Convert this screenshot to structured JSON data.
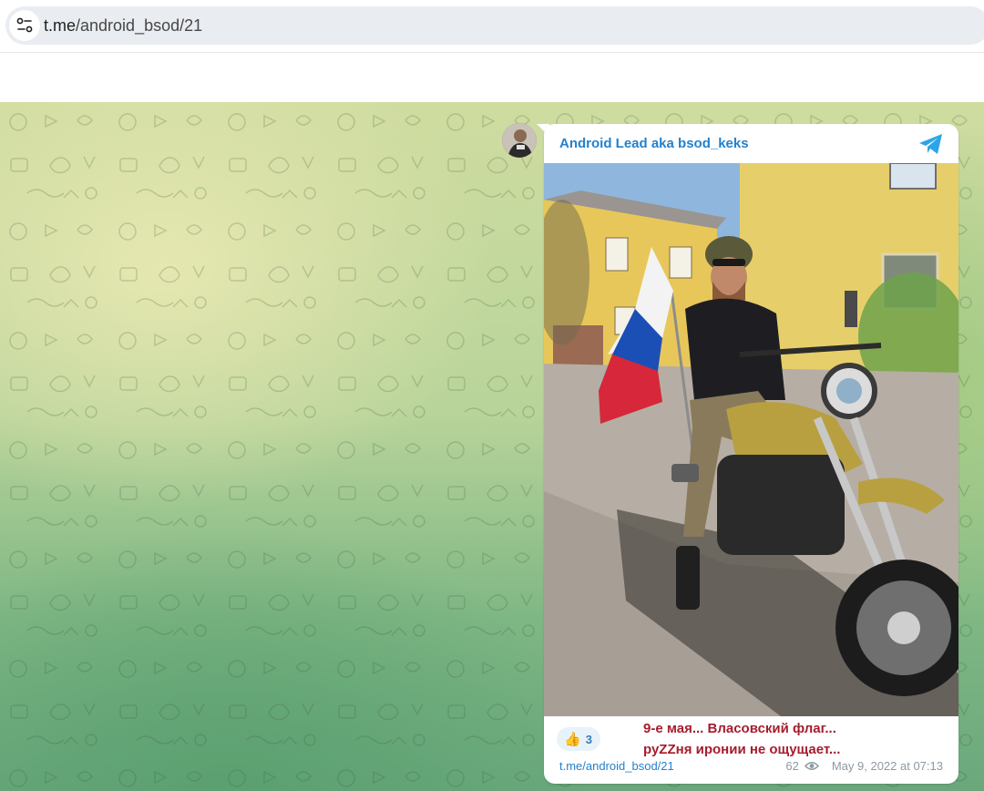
{
  "browser": {
    "url_host": "t.me",
    "url_path": "/android_bsod/21"
  },
  "message": {
    "channel_name": "Android Lead aka bsod_keks",
    "caption_line1": "9-е мая... Власовский флаг...",
    "caption_line2": "руZZня иронии не ощущает...",
    "reaction_emoji": "👍",
    "reaction_count": "3",
    "post_link": "t.me/android_bsod/21",
    "views": "62",
    "date": "May 9, 2022 at 07:13"
  },
  "colors": {
    "accent": "#2481cc",
    "caption": "#a51d2d"
  }
}
